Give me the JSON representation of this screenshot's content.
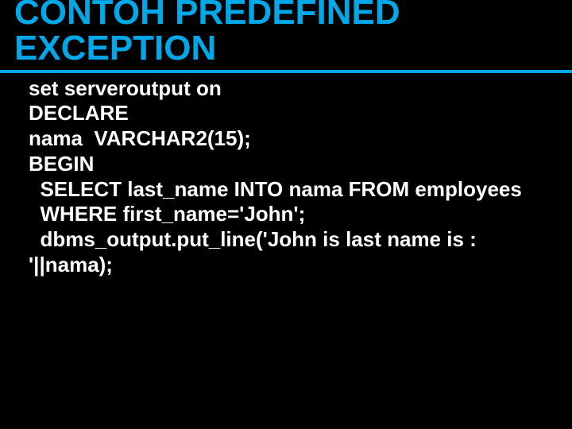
{
  "title": "CONTOH PREDEFINED EXCEPTION",
  "code": {
    "l1": "set serveroutput on",
    "l2": "DECLARE",
    "l3": "nama  VARCHAR2(15);",
    "l4": "BEGIN",
    "l5": "  SELECT last_name INTO nama FROM employees",
    "l6": "  WHERE first_name='John';",
    "l7": "  dbms_output.put_line('John is last name is : '||nama);"
  }
}
